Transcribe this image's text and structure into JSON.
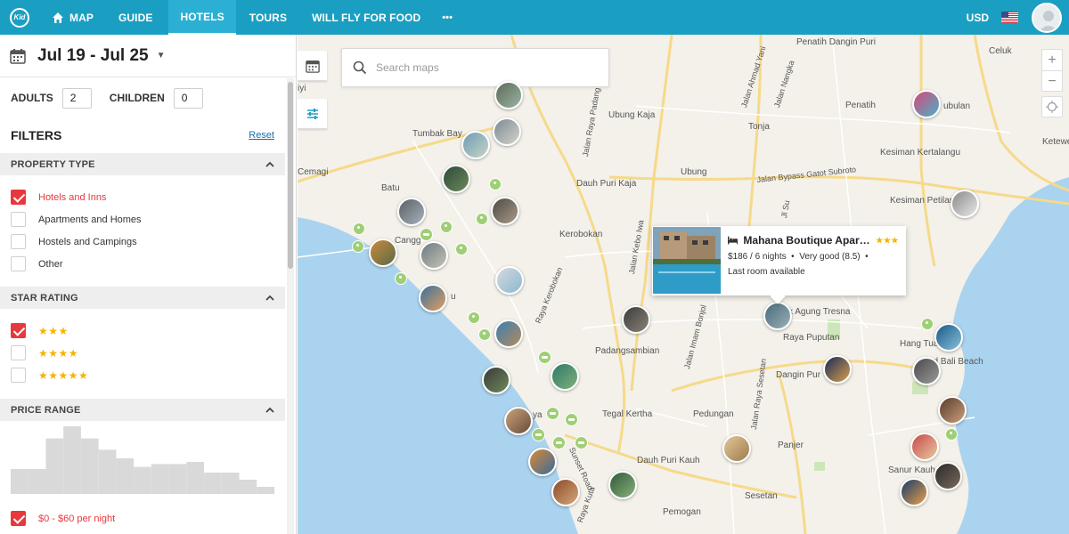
{
  "nav": {
    "logo_text": "Kid",
    "items": [
      "MAP",
      "GUIDE",
      "HOTELS",
      "TOURS",
      "WILL FLY FOR FOOD"
    ],
    "more_icon": "•••",
    "active": "HOTELS",
    "currency": "USD",
    "flag_icon": "us-flag-icon",
    "avatar_icon": "user-avatar-icon"
  },
  "sidebar": {
    "date_range": "Jul 19 - Jul 25",
    "adults_label": "ADULTS",
    "adults_value": "2",
    "children_label": "CHILDREN",
    "children_value": "0",
    "filters_title": "FILTERS",
    "reset_label": "Reset",
    "sections": {
      "property_type": {
        "title": "PROPERTY TYPE",
        "options": [
          {
            "label": "Hotels and Inns",
            "checked": true
          },
          {
            "label": "Apartments and Homes",
            "checked": false
          },
          {
            "label": "Hostels and Campings",
            "checked": false
          },
          {
            "label": "Other",
            "checked": false
          }
        ]
      },
      "star_rating": {
        "title": "STAR RATING",
        "options": [
          {
            "stars": "★★★",
            "checked": true
          },
          {
            "stars": "★★★★",
            "checked": false
          },
          {
            "stars": "★★★★★",
            "checked": false
          }
        ]
      },
      "price_range": {
        "title": "PRICE RANGE",
        "histogram": [
          0.35,
          0.35,
          0.78,
          0.95,
          0.78,
          0.62,
          0.5,
          0.38,
          0.42,
          0.42,
          0.45,
          0.3,
          0.3,
          0.2,
          0.1
        ],
        "selected_option": {
          "label": "$0 - $60 per night",
          "checked": true
        }
      }
    }
  },
  "map": {
    "search_placeholder": "Search maps",
    "zoom_in": "+",
    "zoom_out": "−",
    "labels": {
      "penatih_dangin_puri": "Penatih Dangin Puri",
      "celuk": "Celuk",
      "tumbak_bayuh": "Tumbak Bay",
      "ubung_kaja": "Ubung Kaja",
      "tonja": "Tonja",
      "penatih": "Penatih",
      "tubulan": "ubulan",
      "ketewel": "Ketewe",
      "cemagi": "Cemagi",
      "ubung": "Ubung",
      "kesiman_kertalangu": "Kesiman Kertalangu",
      "batu": "Batu",
      "dauh_puri_kaja": "Dauh Puri Kaja",
      "kesiman_petilan": "Kesiman Petilan",
      "canggu": "Cangg",
      "kerobokan": "Kerobokan",
      "padangsambian": "Padangsambian",
      "agung_tresna": "k Agung Tresna",
      "raya_puputan": "Raya Puputan",
      "hang_tuah": "Hang Tuah",
      "sanur_bali_beach": "nd Bali Beach",
      "dangin_puri": "Dangin Pur",
      "tegal_kertha": "Tegal Kertha",
      "pedungan": "Pedungan",
      "panjer": "Panjer",
      "dauh_puri_kauh": "Dauh Puri Kauh",
      "sanur_kauh": "Sanur Kauh",
      "sesetan": "Sesetan",
      "pemogan": "Pemogan",
      "iyi": "iyi",
      "u": "u",
      "ya": "ya",
      "jalan_ahmad_yani": "Jalan Ahmad Yani",
      "jalan_nangka": "Jalan Nangka",
      "jalan_bypass": "Jalan Bypass Gatot Subroto",
      "jalan_padang_luwih": "Jalan Raya Padang Lu",
      "jalan_kebo_iwa": "Jalan Kebo Iwa",
      "raya_kerobokan": "Raya Kerobokan",
      "jalan_imam_bonjol": "Jalan Imam Bonjol",
      "jalan_raya_sesetan": "Jalan Raya Sesetan",
      "sunset_road": "Sunset Road",
      "raya_kuta": "Raya Kuta",
      "jl_tukad_badung": "Jl Tuk",
      "ji_sulis": "Jl Su"
    },
    "popup": {
      "bed_icon": "bed-icon",
      "name": "Mahana Boutique Apartment",
      "stars": "★★★",
      "price_line": "$186 / 6 nights",
      "rating_line": "Very good (8.5)",
      "availability": "Last room available"
    }
  }
}
